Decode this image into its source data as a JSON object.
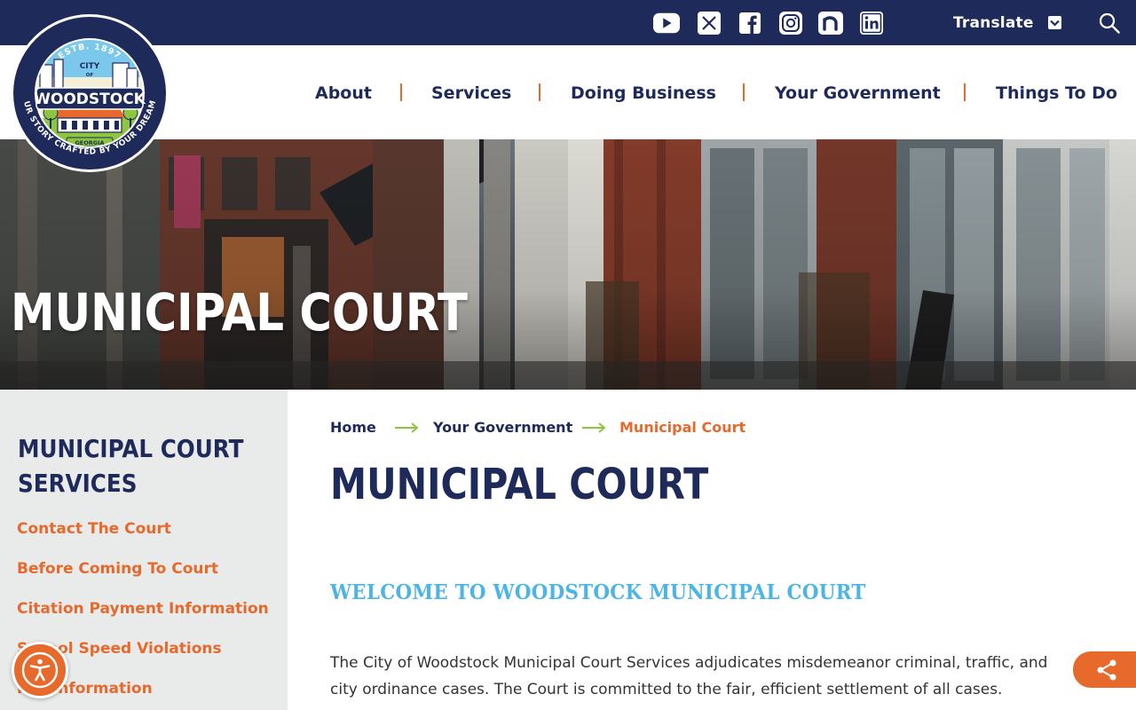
{
  "colors": {
    "navy": "#1e2a5a",
    "orange": "#e8692c",
    "sky": "#4cb5e6",
    "sidebar_bg": "#e9ebea"
  },
  "topbar": {
    "social": [
      "youtube-icon",
      "x-icon",
      "facebook-icon",
      "instagram-icon",
      "nextdoor-icon",
      "linkedin-icon"
    ],
    "translate_label": "Translate"
  },
  "logo": {
    "estb": "ESTB. 1897",
    "city": "CITY",
    "of": "OF",
    "name": "WOODSTOCK",
    "state": "GEORGIA",
    "motto": "OUR STORY CRAFTED BY YOUR DREAMS"
  },
  "nav": {
    "items": [
      "About",
      "Services",
      "Doing Business",
      "Your Government",
      "Things To Do"
    ]
  },
  "hero": {
    "title": "MUNICIPAL COURT"
  },
  "sidebar": {
    "title": "MUNICIPAL COURT SERVICES",
    "links": [
      "Contact The Court",
      "Before Coming To Court",
      "Citation Payment Information",
      "School Speed Violations",
      "Fee Information"
    ]
  },
  "breadcrumb": {
    "home": "Home",
    "parent": "Your Government",
    "current": "Municipal Court"
  },
  "main": {
    "title": "MUNICIPAL COURT",
    "welcome": "WELCOME TO WOODSTOCK MUNICIPAL COURT",
    "intro": "The City of Woodstock Municipal Court Services adjudicates misdemeanor criminal, traffic, and city ordinance cases. The Court is committed to the fair, efficient settlement of all cases."
  },
  "floating": {
    "accessibility": "accessibility-icon",
    "share": "share-icon"
  }
}
